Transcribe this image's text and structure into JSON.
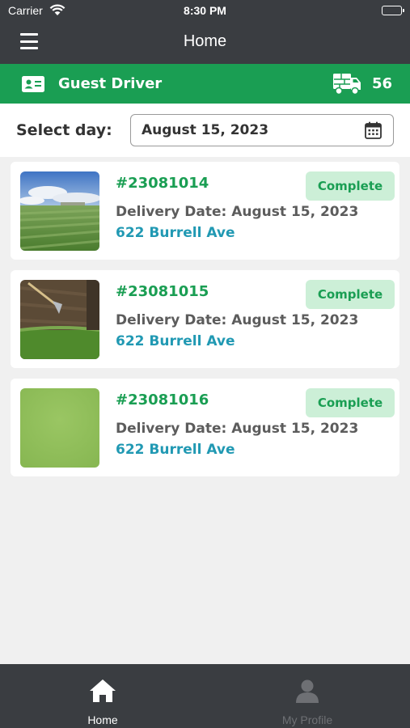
{
  "status_bar": {
    "carrier": "Carrier",
    "time": "8:30 PM"
  },
  "nav": {
    "title": "Home",
    "menu_icon": "hamburger-menu-icon"
  },
  "driver_bar": {
    "name": "Guest Driver",
    "delivery_count": "56",
    "icons": [
      "id-card-icon",
      "truck-icon"
    ]
  },
  "day_selector": {
    "label": "Select day:",
    "value": "August 15, 2023",
    "icon": "calendar-icon"
  },
  "orders": [
    {
      "number": "#23081014",
      "delivery_date": "Delivery Date: August 15, 2023",
      "address": "622 Burrell Ave",
      "status": "Complete"
    },
    {
      "number": "#23081015",
      "delivery_date": "Delivery Date: August 15, 2023",
      "address": "622 Burrell Ave",
      "status": "Complete"
    },
    {
      "number": "#23081016",
      "delivery_date": "Delivery Date: August 15, 2023",
      "address": "622 Burrell Ave",
      "status": "Complete"
    }
  ],
  "tabbar": {
    "tabs": [
      {
        "label": "Home",
        "icon": "home-icon",
        "active": true
      },
      {
        "label": "My Profile",
        "icon": "profile-icon",
        "active": false
      }
    ]
  },
  "colors": {
    "header": "#3a3d41",
    "brand_green": "#1a9e53",
    "badge_bg": "#ccefd7",
    "address_blue": "#2199b3",
    "tab_inactive": "#6e7074"
  }
}
